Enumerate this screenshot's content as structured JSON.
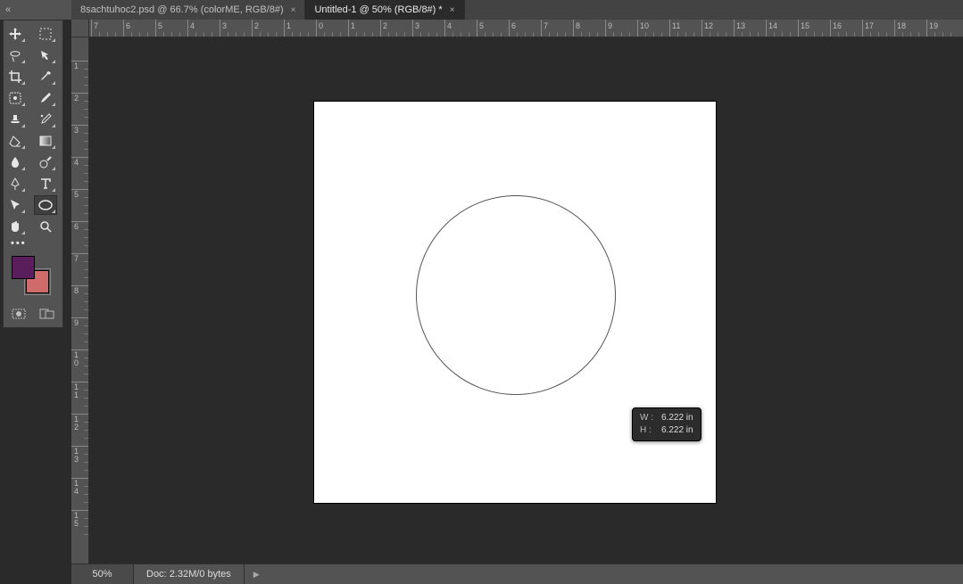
{
  "tabbar_lead_glyph": "«",
  "tabs": [
    {
      "label": "8sachtuhoc2.psd @ 66.7% (colorME, RGB/8#)",
      "active": false
    },
    {
      "label": "Untitled-1 @ 50% (RGB/8#) *",
      "active": true
    }
  ],
  "ruler_h_labels": [
    "7",
    "6",
    "5",
    "4",
    "3",
    "2",
    "1",
    "0",
    "1",
    "2",
    "3",
    "4",
    "5",
    "6",
    "7",
    "8",
    "9",
    "10",
    "11",
    "12",
    "13",
    "14",
    "15",
    "16",
    "17",
    "18",
    "19"
  ],
  "ruler_v_labels": [
    "1",
    "2",
    "3",
    "4",
    "5",
    "6",
    "7",
    "8",
    "9",
    "10",
    "11",
    "12",
    "13",
    "14",
    "15"
  ],
  "ruler_h_origin_index": 7,
  "dimension_tooltip": {
    "w_label": "W :",
    "w_value": "6.222 in",
    "h_label": "H :",
    "h_value": "6.222 in"
  },
  "swatches": {
    "foreground": "#5a1e5d",
    "background": "#cf6b6b"
  },
  "status": {
    "zoom": "50%",
    "doc_label": "Doc:",
    "doc_value": "2.32M/0 bytes",
    "caret": "▶"
  },
  "more_tools_glyph": "•••"
}
